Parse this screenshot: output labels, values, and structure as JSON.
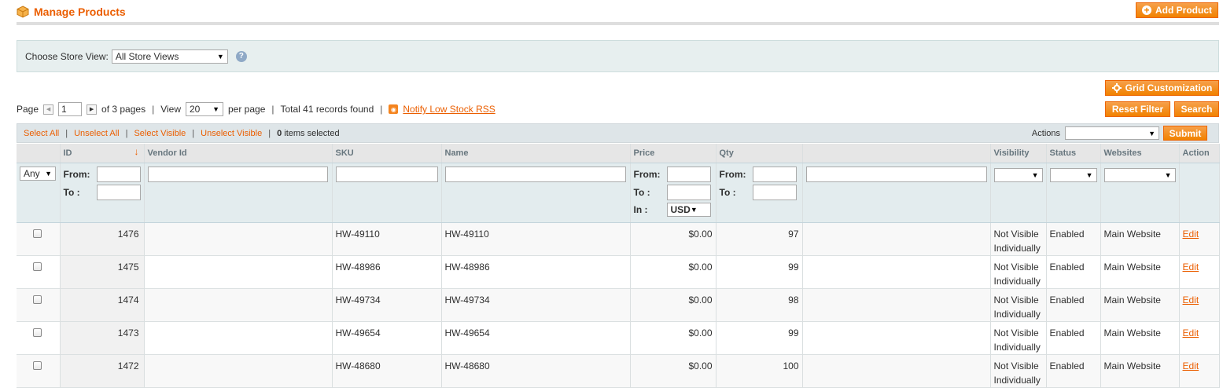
{
  "header": {
    "title": "Manage Products",
    "add_button": "Add Product",
    "grid_custom_button": "Grid Customization",
    "reset_button": "Reset Filter",
    "search_button": "Search"
  },
  "store_switcher": {
    "label": "Choose Store View:",
    "selected": "All Store Views",
    "help": "?"
  },
  "pager": {
    "page_label": "Page",
    "page_value": "1",
    "of_pages": "of 3 pages",
    "view_label": "View",
    "view_value": "20",
    "per_page": "per page",
    "total": "Total 41 records found",
    "rss_link": "Notify Low Stock RSS"
  },
  "massaction": {
    "select_all": "Select All",
    "unselect_all": "Unselect All",
    "select_visible": "Select Visible",
    "unselect_visible": "Unselect Visible",
    "count": "0",
    "items_selected": "items selected",
    "actions_label": "Actions",
    "submit": "Submit"
  },
  "columns": [
    "ID",
    "Vendor Id",
    "SKU",
    "Name",
    "Price",
    "Qty",
    "",
    "Visibility",
    "Status",
    "Websites",
    "Action"
  ],
  "filters": {
    "any": "Any",
    "from": "From:",
    "to": "To :",
    "in": "In :",
    "currency": "USD"
  },
  "rows": [
    {
      "id": "1476",
      "vendor": "",
      "sku": "HW-49110",
      "name": "HW-49110",
      "price": "$0.00",
      "qty": "97",
      "visibility": "Not Visible Individually",
      "status": "Enabled",
      "websites": "Main Website",
      "action": "Edit"
    },
    {
      "id": "1475",
      "vendor": "",
      "sku": "HW-48986",
      "name": "HW-48986",
      "price": "$0.00",
      "qty": "99",
      "visibility": "Not Visible Individually",
      "status": "Enabled",
      "websites": "Main Website",
      "action": "Edit"
    },
    {
      "id": "1474",
      "vendor": "",
      "sku": "HW-49734",
      "name": "HW-49734",
      "price": "$0.00",
      "qty": "98",
      "visibility": "Not Visible Individually",
      "status": "Enabled",
      "websites": "Main Website",
      "action": "Edit"
    },
    {
      "id": "1473",
      "vendor": "",
      "sku": "HW-49654",
      "name": "HW-49654",
      "price": "$0.00",
      "qty": "99",
      "visibility": "Not Visible Individually",
      "status": "Enabled",
      "websites": "Main Website",
      "action": "Edit"
    },
    {
      "id": "1472",
      "vendor": "",
      "sku": "HW-48680",
      "name": "HW-48680",
      "price": "$0.00",
      "qty": "100",
      "visibility": "Not Visible Individually",
      "status": "Enabled",
      "websites": "Main Website",
      "action": "Edit"
    }
  ],
  "colors": {
    "accent": "#eb5e00",
    "button": "#f18200"
  }
}
